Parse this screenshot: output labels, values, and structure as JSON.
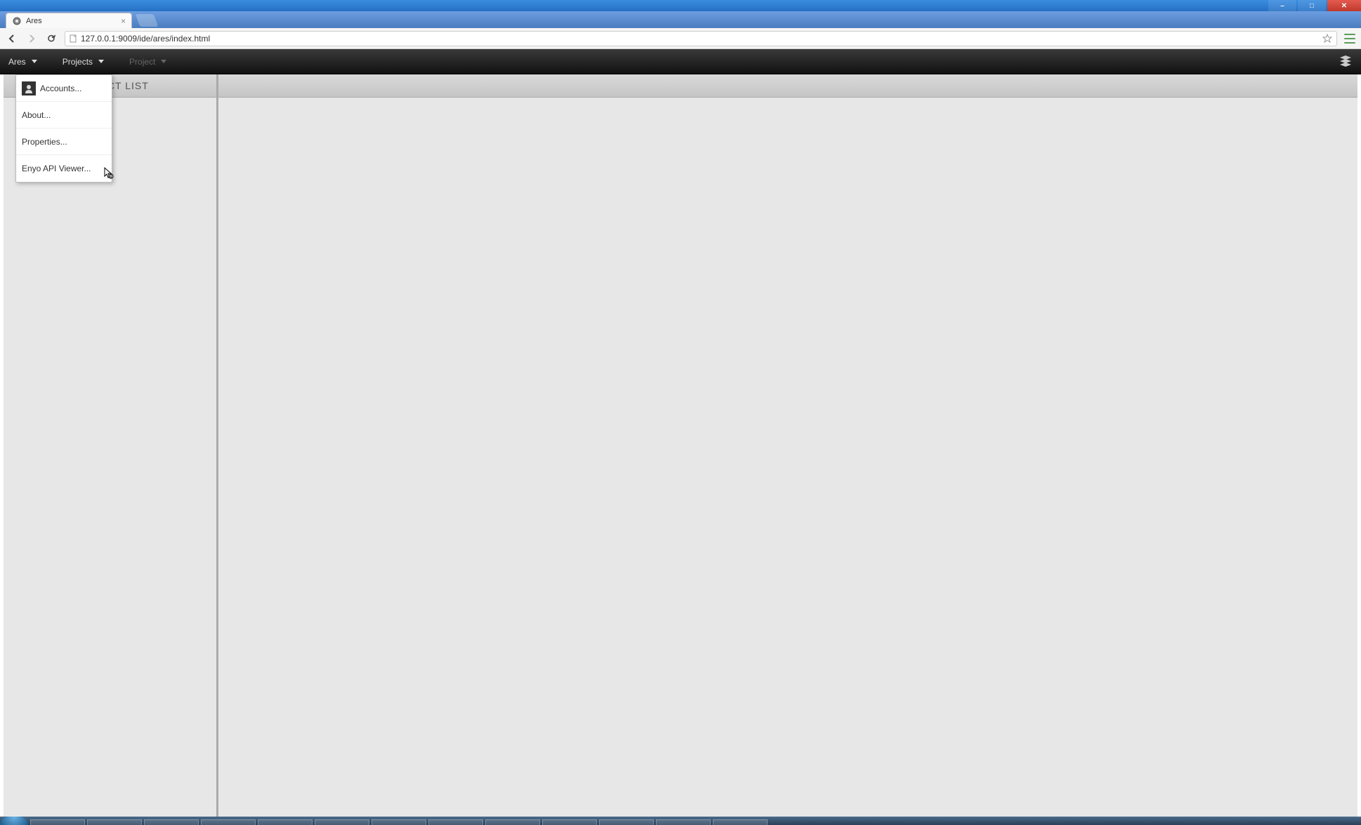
{
  "window": {
    "min": "–",
    "max": "□",
    "close": "✕"
  },
  "browser": {
    "tab_title": "Ares",
    "tab_close": "×",
    "url": "127.0.0.1:9009/ide/ares/index.html"
  },
  "toolbar": {
    "menu1": "Ares",
    "menu2": "Projects",
    "menu3": "Project"
  },
  "sidebar": {
    "header": "PROJECT LIST"
  },
  "dropdown": {
    "items": [
      {
        "label": "Accounts...",
        "icon": true
      },
      {
        "label": "About...",
        "icon": false
      },
      {
        "label": "Properties...",
        "icon": false
      },
      {
        "label": "Enyo API Viewer...",
        "icon": false
      }
    ]
  }
}
